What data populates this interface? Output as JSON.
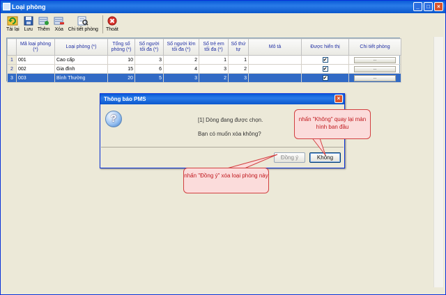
{
  "window": {
    "title": "Loại phòng"
  },
  "toolbar": {
    "buttons": [
      {
        "label": "Tải lại",
        "icon": "refresh-icon"
      },
      {
        "label": "Lưu",
        "icon": "save-icon"
      },
      {
        "label": "Thêm",
        "icon": "add-icon"
      },
      {
        "label": "Xóa",
        "icon": "delete-icon"
      },
      {
        "label": "Chi tiết phòng",
        "icon": "room-detail-icon"
      },
      {
        "label": "Thoát",
        "icon": "exit-icon"
      }
    ]
  },
  "grid": {
    "columns": [
      "Mã loại phòng (*)",
      "Loại phòng (*)",
      "Tổng số phòng (*)",
      "Số người tối đa (*)",
      "Số người lớn tối đa (*)",
      "Số trẻ em tối đa (*)",
      "Số thứ tự",
      "Mô tả",
      "Được hiển thị",
      "Chi tiết phòng"
    ],
    "rows": [
      {
        "index": "1",
        "code": "001",
        "name": "Cao cấp",
        "total": "10",
        "max_people": "3",
        "max_adults": "2",
        "max_children": "1",
        "order": "1",
        "desc": "",
        "visible": "✔",
        "detail": "..."
      },
      {
        "index": "2",
        "code": "002",
        "name": "Gia đình",
        "total": "15",
        "max_people": "6",
        "max_adults": "4",
        "max_children": "3",
        "order": "2",
        "desc": "",
        "visible": "✔",
        "detail": "..."
      },
      {
        "index": "3",
        "code": "003",
        "name": "Bình Thường",
        "total": "20",
        "max_people": "5",
        "max_adults": "3",
        "max_children": "2",
        "order": "3",
        "desc": "",
        "visible": "✔",
        "detail": "..."
      }
    ],
    "selected_row": 2
  },
  "dialog": {
    "title": "Thông báo PMS",
    "message1": "[1] Dòng đang được chọn.",
    "message2": "Bạn có muốn xóa không?",
    "yes_label": "Đồng ý",
    "no_label": "Không"
  },
  "annotations": {
    "no_note": "nhấn \"Không\" quay lại màn hình ban đầu",
    "yes_note": "nhấn \"Đồng ý\" xóa loại phòng này"
  },
  "colors": {
    "title_bar": "#0b57cc",
    "selection": "#316ac5",
    "annotation_text": "#c0161b",
    "annotation_fill": "#fbdcdb"
  }
}
